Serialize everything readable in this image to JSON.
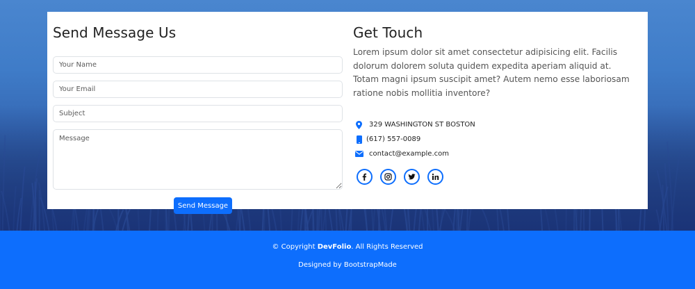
{
  "contact_form": {
    "title": "Send Message Us",
    "name_placeholder": "Your Name",
    "email_placeholder": "Your Email",
    "subject_placeholder": "Subject",
    "message_placeholder": "Message",
    "send_label": "Send Message"
  },
  "contact_info": {
    "title": "Get Touch",
    "about": "Lorem ipsum dolor sit amet consectetur adipisicing elit. Facilis dolorum dolorem soluta quidem expedita aperiam aliquid at. Totam magni ipsum suscipit amet? Autem nemo esse laboriosam ratione nobis mollitia inventore?",
    "address": "329 WASHINGTON ST BOSTON",
    "phone": "(617) 557-0089",
    "email": "contact@example.com",
    "address_icon": "map-pin-icon",
    "phone_icon": "phone-icon",
    "email_icon": "envelope-icon",
    "socials": [
      "facebook-icon",
      "instagram-icon",
      "twitter-icon",
      "linkedin-icon"
    ]
  },
  "footer": {
    "copyright_prefix": "© Copyright ",
    "brand": "DevFolio",
    "copyright_suffix": ". All Rights Reserved",
    "designed_by_prefix": "Designed by ",
    "designed_by_link": "BootstrapMade"
  },
  "colors": {
    "accent": "#0d6efd",
    "footer_bg": "#0d6efd",
    "card_bg": "#ffffff"
  }
}
